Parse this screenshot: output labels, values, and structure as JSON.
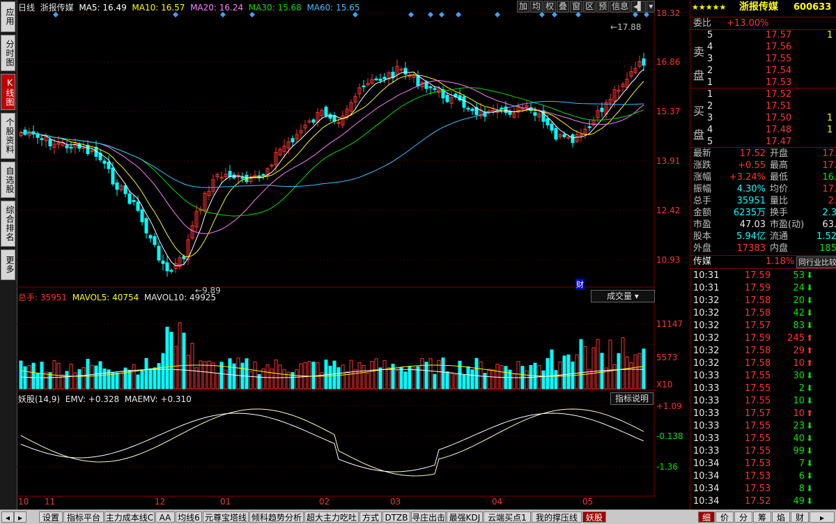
{
  "left_nav": [
    {
      "label": "应用",
      "active": false
    },
    {
      "label": "分时图",
      "active": false
    },
    {
      "label": "K线图",
      "active": true
    },
    {
      "label": "个股资料",
      "active": false
    },
    {
      "label": "自选股",
      "active": false
    },
    {
      "label": "综合排名",
      "active": false
    },
    {
      "label": "更多",
      "active": false
    }
  ],
  "chart_header": {
    "period": "日线",
    "stock_name": "浙报传媒",
    "ma5": "MA5: 16.49",
    "ma10": "MA10: 16.57",
    "ma20": "MA20: 16.24",
    "ma30": "MA30: 15.68",
    "ma60": "MA60: 15.65",
    "buttons": [
      "加",
      "均",
      "权",
      "叠",
      "窗",
      "区",
      "预",
      "信息"
    ]
  },
  "price_axis": [
    "18.32",
    "16.86",
    "15.37",
    "13.91",
    "12.42",
    "10.93"
  ],
  "annotations": {
    "high": "17.88",
    "low": "9.89",
    "finance_marker": "财"
  },
  "volume_panel": {
    "label_total": "总手: 35951",
    "mavol5": "MAVOL5: 40754",
    "mavol10": "MAVOL10: 49925",
    "dropdown": "成交量",
    "axis": [
      "11147",
      "5573"
    ],
    "unit": "X10"
  },
  "indicator_panel": {
    "title": "妖股(14,9)",
    "emv": "EMV: +0.328",
    "maemv": "MAEMV: +0.310",
    "button": "指标说明",
    "axis": [
      "+1.09",
      "-0.138",
      "-1.36"
    ]
  },
  "x_axis": [
    "10",
    "11",
    "12",
    "01",
    "02",
    "03",
    "04",
    "05"
  ],
  "quote": {
    "stars": "★★★★★",
    "name": "浙报传媒",
    "code": "600633",
    "weibi_label": "委比",
    "weibi_value": "+13.00%",
    "sell_label": "卖盘",
    "buy_label": "买盘",
    "sell": [
      {
        "lvl": "5",
        "price": "17.57",
        "vol": "1"
      },
      {
        "lvl": "4",
        "price": "17.56",
        "vol": ""
      },
      {
        "lvl": "3",
        "price": "17.55",
        "vol": ""
      },
      {
        "lvl": "2",
        "price": "17.54",
        "vol": ""
      },
      {
        "lvl": "1",
        "price": "17.53",
        "vol": ""
      }
    ],
    "buy": [
      {
        "lvl": "1",
        "price": "17.52",
        "vol": ""
      },
      {
        "lvl": "2",
        "price": "17.51",
        "vol": ""
      },
      {
        "lvl": "3",
        "price": "17.50",
        "vol": "1"
      },
      {
        "lvl": "4",
        "price": "17.48",
        "vol": "1"
      },
      {
        "lvl": "5",
        "price": "17.47",
        "vol": ""
      }
    ],
    "stats": [
      {
        "l1": "最新",
        "v1": "17.52",
        "c1": "red",
        "l2": "开盘",
        "v2": "17.",
        "c2": "red"
      },
      {
        "l1": "涨跌",
        "v1": "+0.55",
        "c1": "red",
        "l2": "最高",
        "v2": "17.",
        "c2": "red"
      },
      {
        "l1": "涨幅",
        "v1": "+3.24%",
        "c1": "red",
        "l2": "最低",
        "v2": "16.",
        "c2": "green"
      },
      {
        "l1": "振幅",
        "v1": "4.30%",
        "c1": "cyan",
        "l2": "均价",
        "v2": "17.",
        "c2": "red"
      },
      {
        "l1": "总手",
        "v1": "35951",
        "c1": "cyan",
        "l2": "量比",
        "v2": "2.",
        "c2": "red"
      },
      {
        "l1": "金额",
        "v1": "6235万",
        "c1": "cyan",
        "l2": "换手",
        "v2": "2.3",
        "c2": "cyan"
      },
      {
        "l1": "市盈",
        "v1": "47.03",
        "c1": "white",
        "l2": "市盈(动)",
        "v2": "63.",
        "c2": "white"
      },
      {
        "l1": "股本",
        "v1": "5.94亿",
        "c1": "cyan",
        "l2": "流通",
        "v2": "1.52",
        "c2": "cyan"
      },
      {
        "l1": "外盘",
        "v1": "17383",
        "c1": "red",
        "l2": "内盘",
        "v2": "185",
        "c2": "green"
      }
    ],
    "sector_label": "传媒",
    "sector_change": "1.18%",
    "sector_button": "同行业比较",
    "ticks": [
      {
        "t": "10:31",
        "p": "17.59",
        "v": "53",
        "d": "down"
      },
      {
        "t": "10:31",
        "p": "17.59",
        "v": "24",
        "d": "down"
      },
      {
        "t": "10:32",
        "p": "17.58",
        "v": "20",
        "d": "down"
      },
      {
        "t": "10:32",
        "p": "17.58",
        "v": "42",
        "d": "down"
      },
      {
        "t": "10:32",
        "p": "17.57",
        "v": "83",
        "d": "down"
      },
      {
        "t": "10:32",
        "p": "17.59",
        "v": "245",
        "d": "up"
      },
      {
        "t": "10:32",
        "p": "17.58",
        "v": "29",
        "d": "up"
      },
      {
        "t": "10:32",
        "p": "17.58",
        "v": "10",
        "d": "up"
      },
      {
        "t": "10:33",
        "p": "17.55",
        "v": "30",
        "d": "down"
      },
      {
        "t": "10:33",
        "p": "17.55",
        "v": "2",
        "d": "down"
      },
      {
        "t": "10:33",
        "p": "17.55",
        "v": "10",
        "d": "down"
      },
      {
        "t": "10:33",
        "p": "17.57",
        "v": "10",
        "d": "up"
      },
      {
        "t": "10:33",
        "p": "17.55",
        "v": "23",
        "d": "down"
      },
      {
        "t": "10:33",
        "p": "17.55",
        "v": "40",
        "d": "down"
      },
      {
        "t": "10:33",
        "p": "17.55",
        "v": "99",
        "d": "down"
      },
      {
        "t": "10:34",
        "p": "17.53",
        "v": "7",
        "d": "down"
      },
      {
        "t": "10:34",
        "p": "17.53",
        "v": "6",
        "d": "down"
      },
      {
        "t": "10:34",
        "p": "17.53",
        "v": "8",
        "d": "down"
      },
      {
        "t": "10:34",
        "p": "17.52",
        "v": "49",
        "d": "down"
      }
    ],
    "bottom_tabs": [
      "细",
      "价",
      "分",
      "筹",
      "焰",
      "财"
    ]
  },
  "bottom_tabs": [
    "设置",
    "指标平台",
    "主力成本线C",
    "AA",
    "均线6",
    "元尊宝塔线",
    "倾科趋势分析",
    "超大主力吃吐",
    "方式",
    "DTZB",
    "寻庄出击",
    "最强KDJ",
    "云端买点1",
    "我的撑压线",
    "妖股"
  ],
  "colors": {
    "up": "#ff3232",
    "down": "#00ffff",
    "ma5": "#ffffff",
    "ma10": "#ffff00",
    "ma20": "#ff80ff",
    "ma30": "#00e000",
    "ma60": "#40c0ff"
  }
}
